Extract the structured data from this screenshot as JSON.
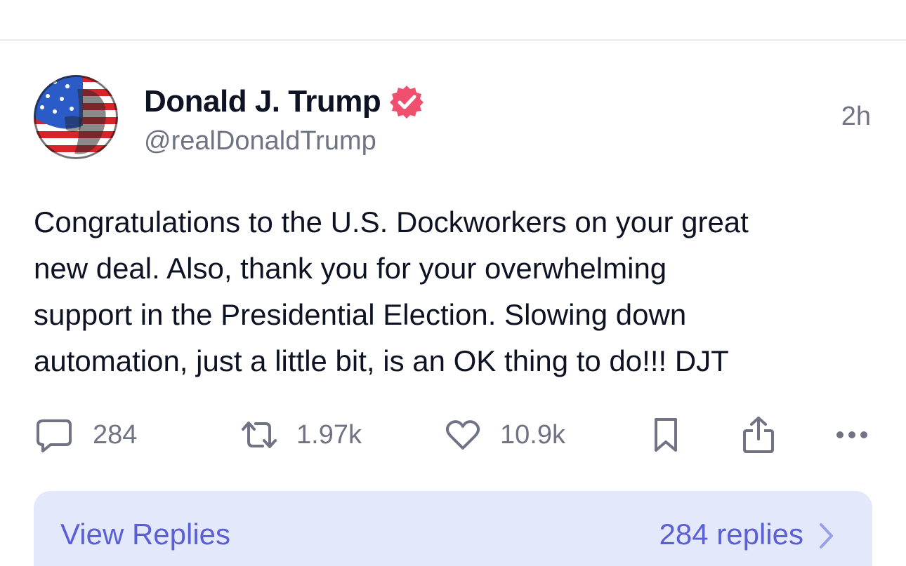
{
  "post": {
    "author": {
      "display_name": "Donald J. Trump",
      "handle": "@realDonaldTrump",
      "verified": true
    },
    "timestamp": "2h",
    "body_lines": [
      "Congratulations to the U.S. Dockworkers on your great",
      "new deal. Also, thank you for your overwhelming",
      "support in the Presidential Election. Slowing down",
      "automation, just a little bit, is an OK thing to do!!! DJT"
    ],
    "actions": {
      "replies_count": "284",
      "reposts_count": "1.97k",
      "likes_count": "10.9k"
    },
    "replies_bar": {
      "label": "View Replies",
      "count_label": "284 replies"
    }
  },
  "icons": {
    "reply": "comment-bubble-icon",
    "repost": "repost-arrows-icon",
    "like": "heart-icon",
    "bookmark": "bookmark-icon",
    "share": "share-icon",
    "more": "more-dots-icon",
    "verified": "verified-badge-icon",
    "chevron": "chevron-right-icon"
  },
  "colors": {
    "text_primary": "#0e1324",
    "text_secondary": "#6f7384",
    "verified_badge": "#f0506e",
    "accent": "#5a5ed7",
    "replies_bar_bg": "#e3e8fb"
  }
}
